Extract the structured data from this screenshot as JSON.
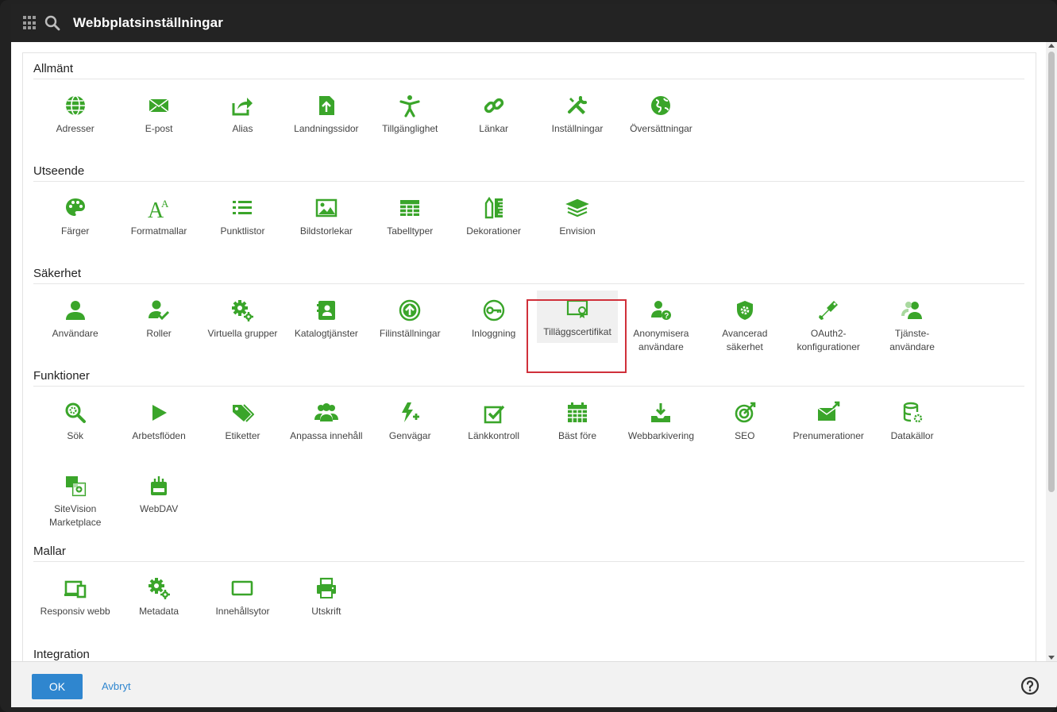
{
  "window": {
    "title": "Webbplatsinställningar"
  },
  "sections": [
    {
      "title": "Allmänt",
      "items": [
        {
          "label": "Adresser",
          "icon": "globe-icon"
        },
        {
          "label": "E-post",
          "icon": "envelope-icon"
        },
        {
          "label": "Alias",
          "icon": "share-icon"
        },
        {
          "label": "Landningssidor",
          "icon": "landing-page-icon"
        },
        {
          "label": "Tillgänglighet",
          "icon": "accessibility-icon"
        },
        {
          "label": "Länkar",
          "icon": "link-icon"
        },
        {
          "label": "Inställningar",
          "icon": "tools-icon"
        },
        {
          "label": "Översättningar",
          "icon": "earth-icon"
        }
      ]
    },
    {
      "title": "Utseende",
      "items": [
        {
          "label": "Färger",
          "icon": "palette-icon"
        },
        {
          "label": "Formatmallar",
          "icon": "font-icon"
        },
        {
          "label": "Punktlistor",
          "icon": "list-icon"
        },
        {
          "label": "Bildstorlekar",
          "icon": "image-icon"
        },
        {
          "label": "Tabelltyper",
          "icon": "table-icon"
        },
        {
          "label": "Dekorationer",
          "icon": "decoration-icon"
        },
        {
          "label": "Envision",
          "icon": "layers-icon"
        }
      ]
    },
    {
      "title": "Säkerhet",
      "items": [
        {
          "label": "Användare",
          "icon": "user-icon"
        },
        {
          "label": "Roller",
          "icon": "user-check-icon"
        },
        {
          "label": "Virtuella grupper",
          "icon": "gears-icon"
        },
        {
          "label": "Katalogtjänster",
          "icon": "directory-icon"
        },
        {
          "label": "Filinställningar",
          "icon": "upload-circle-icon"
        },
        {
          "label": "Inloggning",
          "icon": "key-circle-icon"
        },
        {
          "label": "Tilläggscertifikat",
          "icon": "certificate-icon",
          "hover": true
        },
        {
          "label": "Anonymisera användare",
          "icon": "user-question-icon"
        },
        {
          "label": "Avancerad säkerhet",
          "icon": "shield-gear-icon"
        },
        {
          "label": "OAuth2-konfigurationer",
          "icon": "oauth-key-icon"
        },
        {
          "label": "Tjänste-användare",
          "icon": "service-user-icon"
        }
      ]
    },
    {
      "title": "Funktioner",
      "items": [
        {
          "label": "Sök",
          "icon": "search-gear-icon"
        },
        {
          "label": "Arbetsflöden",
          "icon": "play-icon"
        },
        {
          "label": "Etiketter",
          "icon": "tags-icon"
        },
        {
          "label": "Anpassa innehåll",
          "icon": "users-icon"
        },
        {
          "label": "Genvägar",
          "icon": "bolt-plus-icon"
        },
        {
          "label": "Länkkontroll",
          "icon": "check-square-icon"
        },
        {
          "label": "Bäst före",
          "icon": "calendar-icon"
        },
        {
          "label": "Webbarkivering",
          "icon": "download-tray-icon"
        },
        {
          "label": "SEO",
          "icon": "target-icon"
        },
        {
          "label": "Prenumerationer",
          "icon": "envelope-arrow-icon"
        },
        {
          "label": "Datakällor",
          "icon": "database-gear-icon"
        },
        {
          "label": "SiteVision Marketplace",
          "icon": "marketplace-icon"
        },
        {
          "label": "WebDAV",
          "icon": "webdav-icon"
        }
      ]
    },
    {
      "title": "Mallar",
      "items": [
        {
          "label": "Responsiv webb",
          "icon": "devices-icon"
        },
        {
          "label": "Metadata",
          "icon": "gears-icon"
        },
        {
          "label": "Innehållsytor",
          "icon": "rectangle-icon"
        },
        {
          "label": "Utskrift",
          "icon": "printer-icon"
        }
      ]
    },
    {
      "title": "Integration",
      "items": []
    }
  ],
  "footer": {
    "ok_label": "OK",
    "cancel_label": "Avbryt"
  },
  "colors": {
    "accent": "#3aa52a",
    "primary": "#2f86cf",
    "highlight": "#d0303a"
  }
}
